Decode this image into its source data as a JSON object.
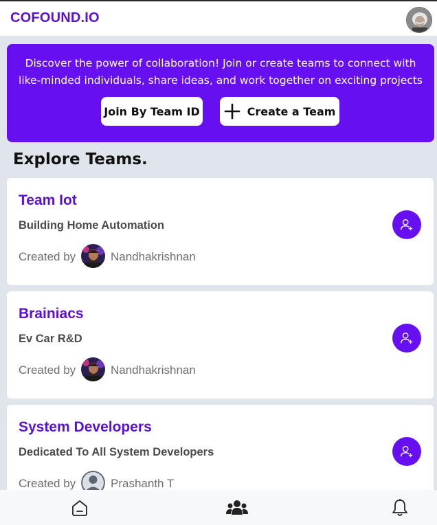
{
  "app": {
    "brand": "COFOUND.IO"
  },
  "hero": {
    "text": "Discover the power of collaboration! Join or create teams to connect with like-minded individuals, share ideas, and work together on exciting projects",
    "join_label": "Join By Team ID",
    "create_label": "Create a Team"
  },
  "section": {
    "title": "Explore Teams."
  },
  "teams": [
    {
      "name": "Team Iot",
      "description": "Building Home Automation",
      "created_by_label": "Created by",
      "creator": "Nandhakrishnan"
    },
    {
      "name": "Brainiacs",
      "description": "Ev Car R&D",
      "created_by_label": "Created by",
      "creator": "Nandhakrishnan"
    },
    {
      "name": "System Developers",
      "description": "Dedicated To All System Developers",
      "created_by_label": "Created by",
      "creator": "Prashanth T"
    }
  ],
  "nav": {
    "items": [
      "home-icon",
      "teams-icon",
      "bell-icon"
    ]
  },
  "colors": {
    "accent": "#6610f2",
    "brand": "#5b10d6",
    "background": "#dfe5ea"
  }
}
